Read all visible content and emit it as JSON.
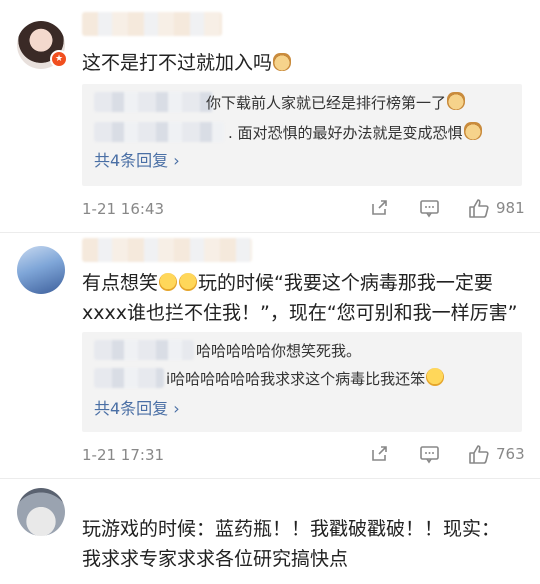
{
  "comments": [
    {
      "text": "这不是打不过就加入吗",
      "reply_lines": [
        "你下载前人家就已经是排行榜第一了",
        ". 面对恐惧的最好办法就是变成恐惧"
      ],
      "reply_more": "共4条回复 ›",
      "time": "1-21 16:43",
      "likes": "981"
    },
    {
      "text_line1": "有点想笑",
      "text_line1b": "玩的时候“我要这个病毒那我一定要",
      "text_line2": "xxxx谁也拦不住我！”，现在“您可别和我一样厉害”",
      "reply_lines": [
        "哈哈哈哈哈你想笑死我。",
        "i哈哈哈哈哈哈我求求这个病毒比我还笨"
      ],
      "reply_more": "共4条回复 ›",
      "time": "1-21 17:31",
      "likes": "763"
    },
    {
      "text_line1": "玩游戏的时候：蓝药瓶！！我戳破戳破！！现实：",
      "text_line2": "我求求专家求求各位研究搞快点"
    }
  ]
}
